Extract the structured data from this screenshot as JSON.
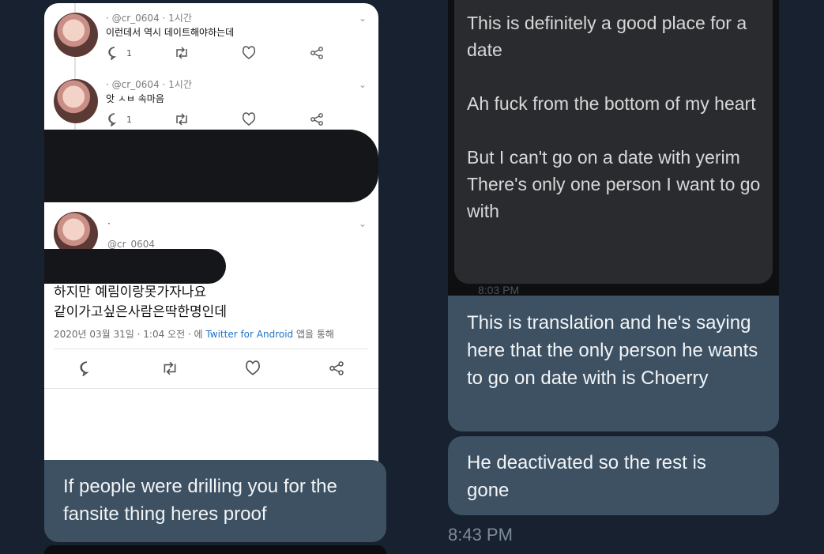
{
  "tweets": [
    {
      "handle": "· @cr_0604 · 1시간",
      "text": "이런데서 역시 데이트해야하는데",
      "replies": "1"
    },
    {
      "handle": "· @cr_0604 · 1시간",
      "text": "앗 ㅅㅂ 속마음",
      "replies": "1"
    }
  ],
  "main_tweet": {
    "dot": "·",
    "handle": "@cr_0604",
    "line1": "하지만 예림이랑못가자나요",
    "line2": "같이가고싶은사람은딱한명인데",
    "meta_prefix": "2020년 03월 31일 · 1:04 오전 · 에 ",
    "meta_link": "Twitter for Android",
    "meta_suffix": " 앱을 통해"
  },
  "left_message": "If people were drilling you for the fansite thing heres proof",
  "translation_bubble": "This is definitely a good place for a date\n\nAh fuck from the bottom of my heart\n\nBut I can't go on a date with yerim\nThere's only one person I want to go with",
  "ghost_time": "8:03 PM",
  "message_1": "This is translation and he's saying here that the only person he wants to go on date with is Choerry",
  "message_2": "He deactivated so the rest is gone",
  "timestamp": "8:43 PM",
  "colors": {
    "background": "#17212f",
    "bubble": "#3d5163",
    "dark_bubble": "#2a2b2f"
  }
}
